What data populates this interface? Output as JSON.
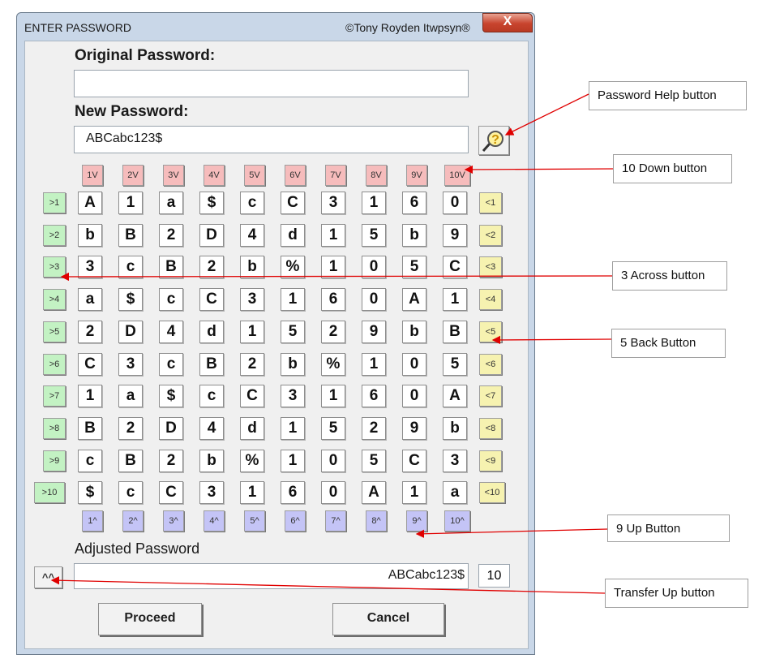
{
  "window": {
    "title": "ENTER PASSWORD",
    "copyright": "©Tony Royden Itwpsyn®",
    "close_label": "X"
  },
  "form": {
    "original_label": "Original Password:",
    "original_value": "",
    "new_label": "New Password:",
    "new_value": "ABCabc123$",
    "help_icon": "magnifier-question-icon",
    "adjusted_label": "Adjusted Password",
    "adjusted_value": "ABCabc123$",
    "adjusted_length": "10",
    "transfer_label": "^^",
    "proceed_label": "Proceed",
    "cancel_label": "Cancel"
  },
  "grid": {
    "down_buttons": [
      "1V",
      "2V",
      "3V",
      "4V",
      "5V",
      "6V",
      "7V",
      "8V",
      "9V",
      "10V"
    ],
    "up_buttons": [
      "1^",
      "2^",
      "3^",
      "4^",
      "5^",
      "6^",
      "7^",
      "8^",
      "9^",
      "10^"
    ],
    "across_buttons": [
      ">1",
      ">2",
      ">3",
      ">4",
      ">5",
      ">6",
      ">7",
      ">8",
      ">9",
      ">10"
    ],
    "back_buttons": [
      "<1",
      "<2",
      "<3",
      "<4",
      "<5",
      "<6",
      "<7",
      "<8",
      "<9",
      "<10"
    ],
    "rows": [
      [
        "A",
        "1",
        "a",
        "$",
        "c",
        "C",
        "3",
        "1",
        "6",
        "0"
      ],
      [
        "b",
        "B",
        "2",
        "D",
        "4",
        "d",
        "1",
        "5",
        "b",
        "9"
      ],
      [
        "3",
        "c",
        "B",
        "2",
        "b",
        "%",
        "1",
        "0",
        "5",
        "C"
      ],
      [
        "a",
        "$",
        "c",
        "C",
        "3",
        "1",
        "6",
        "0",
        "A",
        "1"
      ],
      [
        "2",
        "D",
        "4",
        "d",
        "1",
        "5",
        "2",
        "9",
        "b",
        "B"
      ],
      [
        "C",
        "3",
        "c",
        "B",
        "2",
        "b",
        "%",
        "1",
        "0",
        "5"
      ],
      [
        "1",
        "a",
        "$",
        "c",
        "C",
        "3",
        "1",
        "6",
        "0",
        "A"
      ],
      [
        "B",
        "2",
        "D",
        "4",
        "d",
        "1",
        "5",
        "2",
        "9",
        "b"
      ],
      [
        "c",
        "B",
        "2",
        "b",
        "%",
        "1",
        "0",
        "5",
        "C",
        "3"
      ],
      [
        "$",
        "c",
        "C",
        "3",
        "1",
        "6",
        "0",
        "A",
        "1",
        "a"
      ]
    ]
  },
  "callouts": [
    "Password Help button",
    "10 Down button",
    "3 Across button",
    "5 Back Button",
    "9 Up Button",
    "Transfer Up button"
  ],
  "colors": {
    "arrow": "#e00000",
    "down_button": "#f6bcbc",
    "up_button": "#c4c4f6",
    "across_button": "#c3f2c3",
    "back_button": "#f6f2b0"
  }
}
